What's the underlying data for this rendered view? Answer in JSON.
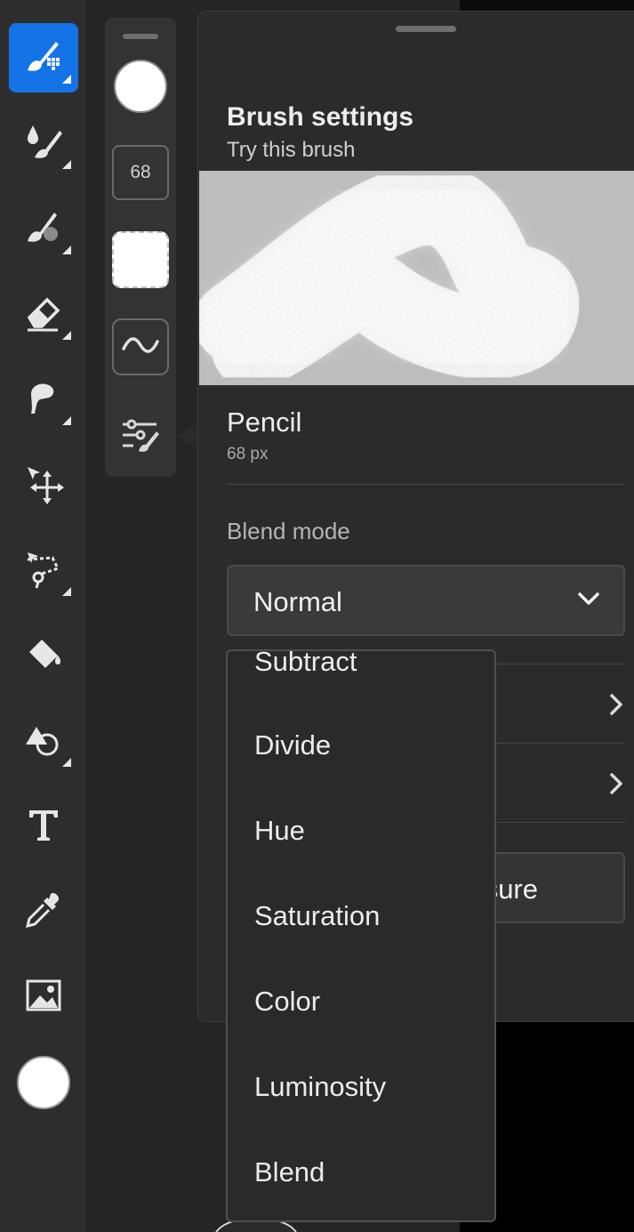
{
  "toolbar": {
    "tools": [
      {
        "name": "brush-tool",
        "icon": "paintbrush-grid-icon",
        "active": true
      },
      {
        "name": "mixer-brush-tool",
        "icon": "drop-brush-icon"
      },
      {
        "name": "smudge-tool",
        "icon": "brush-blob-icon"
      },
      {
        "name": "eraser-tool",
        "icon": "eraser-icon"
      },
      {
        "name": "heal-tool",
        "icon": "healing-icon"
      },
      {
        "name": "move-tool",
        "icon": "move-arrow-icon"
      },
      {
        "name": "lasso-tool",
        "icon": "lasso-icon"
      },
      {
        "name": "fill-tool",
        "icon": "paint-bucket-icon"
      },
      {
        "name": "shape-tool",
        "icon": "shapes-icon"
      },
      {
        "name": "text-tool",
        "icon": "text-t-icon"
      },
      {
        "name": "eyedropper-tool",
        "icon": "eyedropper-icon"
      },
      {
        "name": "image-tool",
        "icon": "image-icon"
      }
    ],
    "color": "#ffffff"
  },
  "minibar": {
    "brush_size": "68"
  },
  "panel": {
    "title": "Brush settings",
    "subtitle": "Try this brush",
    "brush_name": "Pencil",
    "brush_size": "68 px",
    "blend_label": "Blend mode",
    "blend_value": "Normal",
    "pressure_label": "sure"
  },
  "dropdown": {
    "items": [
      "Subtract",
      "Divide",
      "Hue",
      "Saturation",
      "Color",
      "Luminosity",
      "Blend"
    ]
  },
  "colors": {
    "accent": "#1473e6",
    "panel_bg": "#2b2b2b",
    "preview_bg": "#bdbdbd"
  }
}
